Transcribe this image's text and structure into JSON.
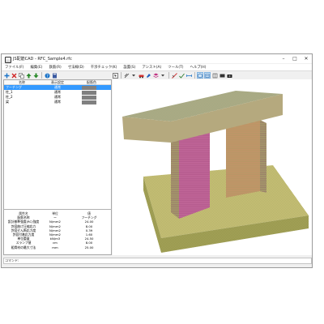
{
  "window": {
    "title": "JS配筋CAD - RFC_Sample4.rfc"
  },
  "menu": [
    "ファイル(F)",
    "編集(E)",
    "鉄筋(R)",
    "寸法線(D)",
    "干渉チェック(K)",
    "設置(S)",
    "アシスト(A)",
    "ツール(T)",
    "ヘルプ(H)"
  ],
  "list": {
    "headers": [
      "名称",
      "表示設定",
      "配筋色"
    ],
    "rows": [
      {
        "name": "フーチング",
        "display": "通常"
      },
      {
        "name": "柱_1",
        "display": "通常"
      },
      {
        "name": "柱_2",
        "display": "通常"
      },
      {
        "name": "梁",
        "display": "通常"
      }
    ]
  },
  "properties": {
    "headers": [
      "属性名",
      "単位",
      "値"
    ],
    "rows": [
      [
        "配筋名称",
        "ー",
        "フーチング"
      ],
      [
        "設計基準強度(RC)強度",
        "N/mm2",
        "24.00"
      ],
      [
        "許容曲げ圧縮応力",
        "N/mm2",
        "8.00"
      ],
      [
        "許容せん断応力度",
        "N/mm2",
        "0.39"
      ],
      [
        "許容付着応力度",
        "N/mm2",
        "1.60"
      ],
      [
        "単位重量",
        "kN/m3",
        "24.50"
      ],
      [
        "スランプ値",
        "cm",
        "8.00"
      ],
      [
        "粗骨材の最大寸法",
        "mm",
        "25.00"
      ]
    ]
  },
  "command": {
    "label": "コマンド:"
  },
  "colors": {
    "selection": "#3399ff",
    "swatch": "#808080",
    "concrete": "#c8c07a",
    "column": "#c46a9c",
    "beam": "#6aa0a8"
  }
}
